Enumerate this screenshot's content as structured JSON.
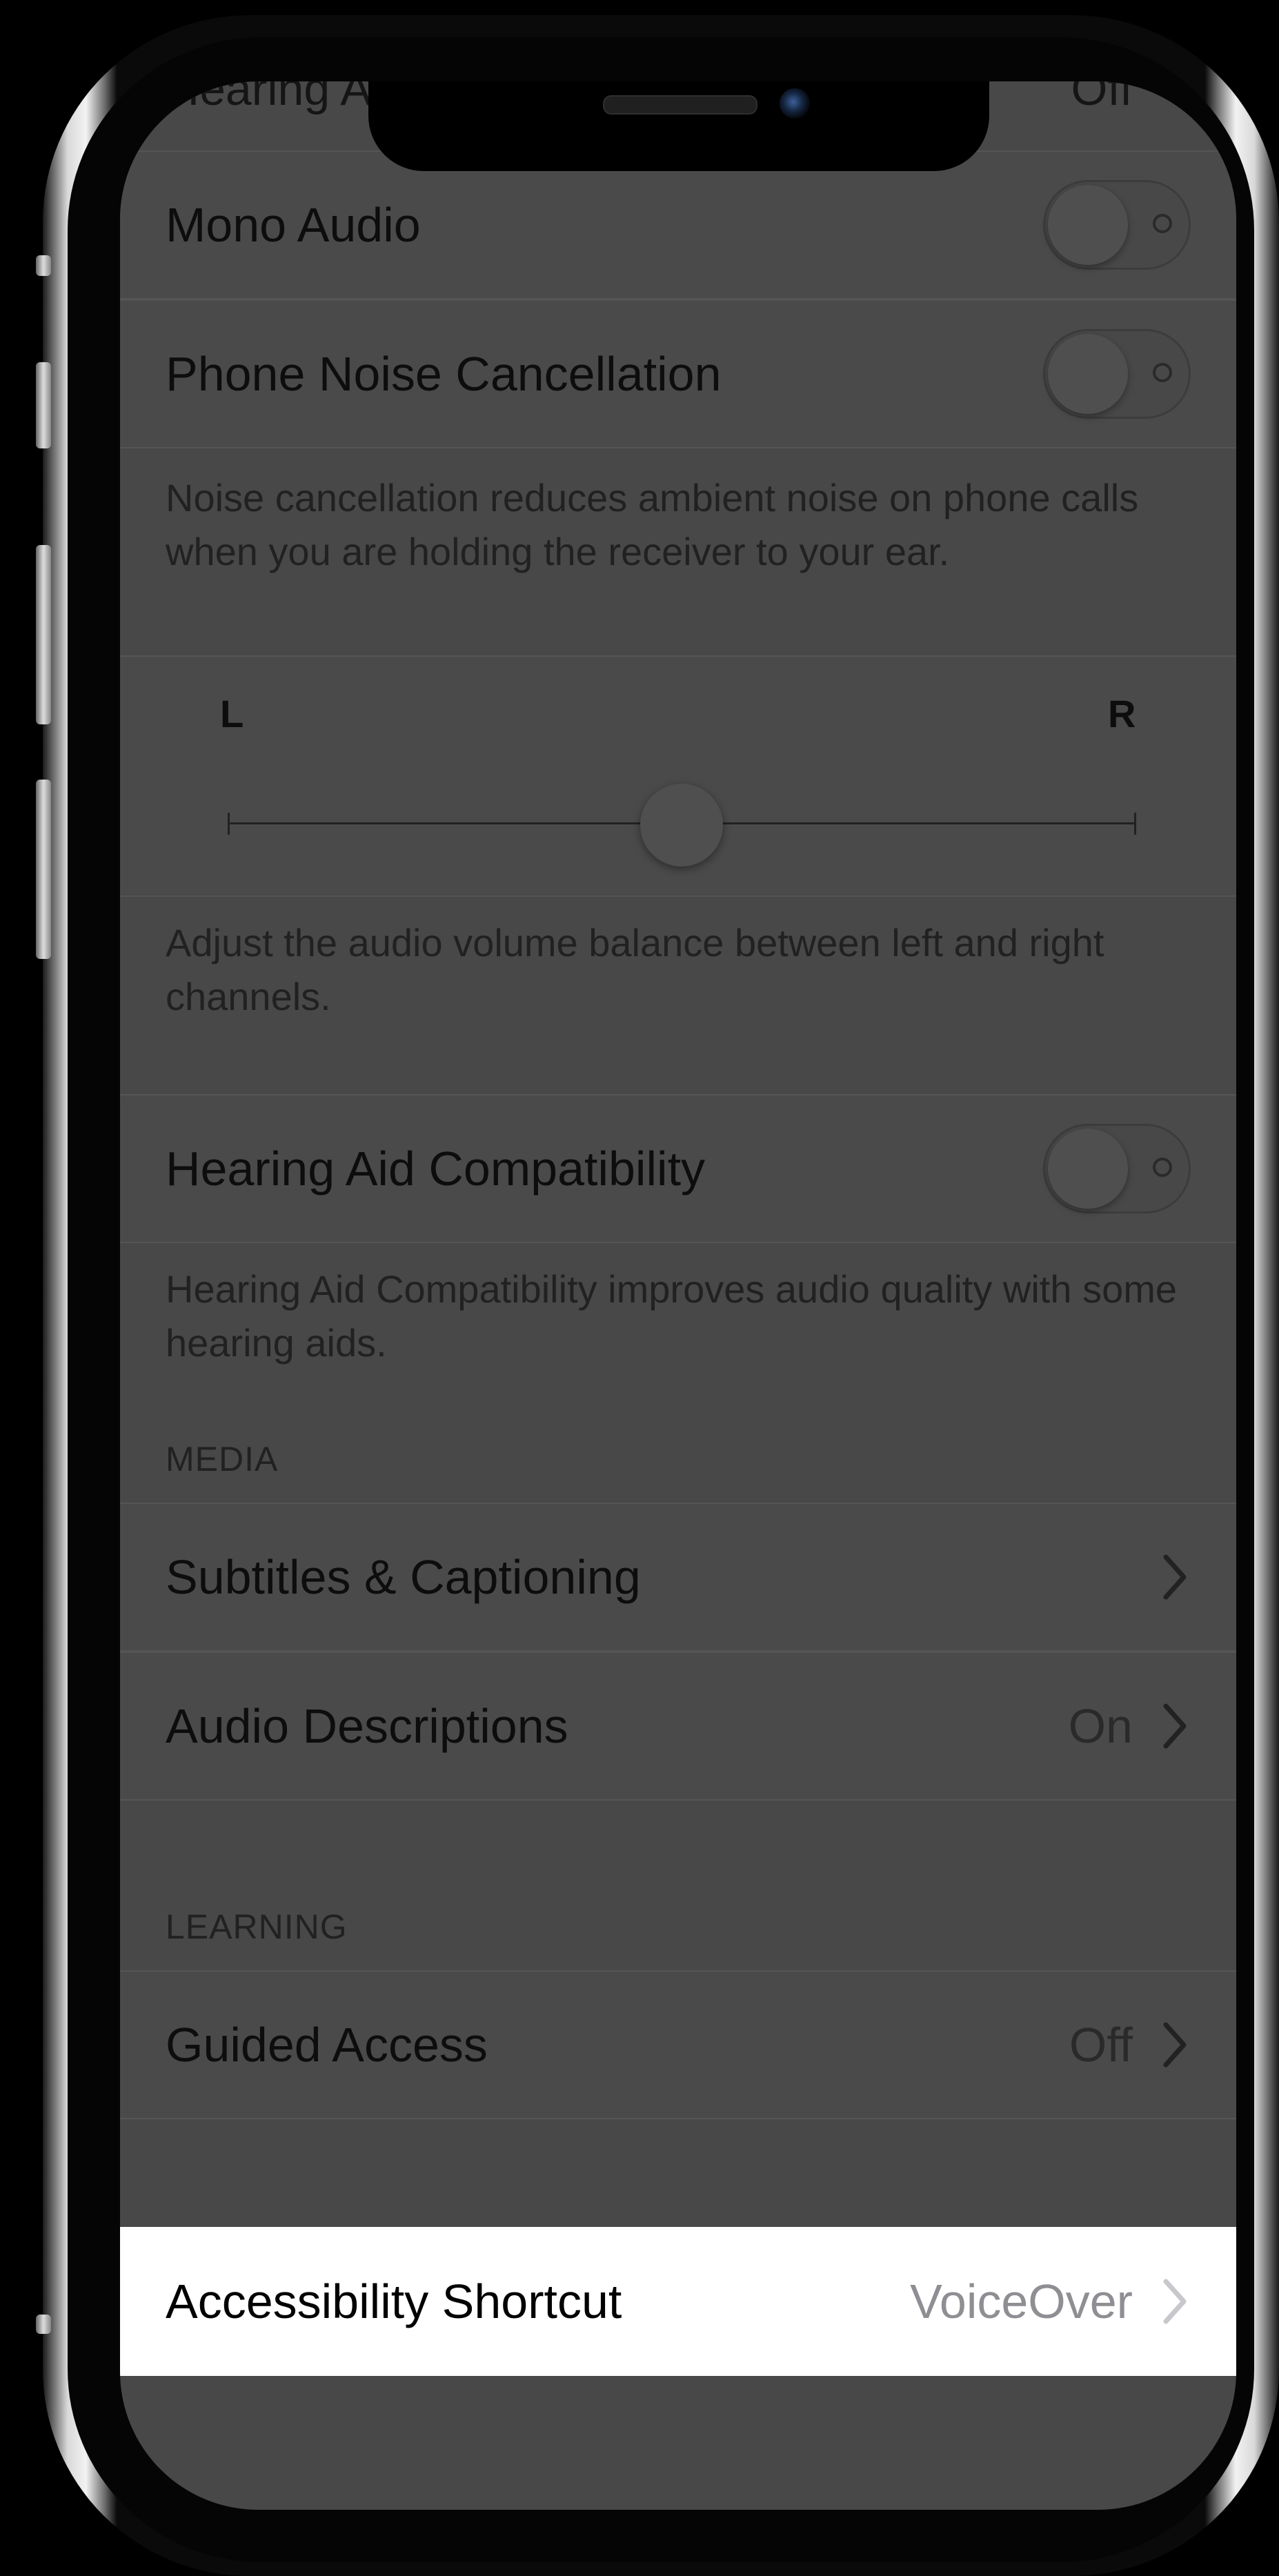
{
  "top_partial": {
    "label": "Hearing Aids",
    "value": "Off"
  },
  "audio_rows": [
    {
      "label": "Mono Audio",
      "toggle_on": false
    },
    {
      "label": "Phone Noise Cancellation",
      "toggle_on": false
    }
  ],
  "noise_footer": "Noise cancellation reduces ambient noise on phone calls when you are holding the receiver to your ear.",
  "balance": {
    "left_label": "L",
    "right_label": "R",
    "position": 0.5
  },
  "balance_footer": "Adjust the audio volume balance between left and right channels.",
  "hac": {
    "label": "Hearing Aid Compatibility",
    "toggle_on": false
  },
  "hac_footer": "Hearing Aid Compatibility improves audio quality with some hearing aids.",
  "media": {
    "header": "MEDIA",
    "rows": [
      {
        "label": "Subtitles & Captioning",
        "value": ""
      },
      {
        "label": "Audio Descriptions",
        "value": "On"
      }
    ]
  },
  "learning": {
    "header": "LEARNING",
    "rows": [
      {
        "label": "Guided Access",
        "value": "Off"
      }
    ]
  },
  "shortcut": {
    "label": "Accessibility Shortcut",
    "value": "VoiceOver"
  }
}
